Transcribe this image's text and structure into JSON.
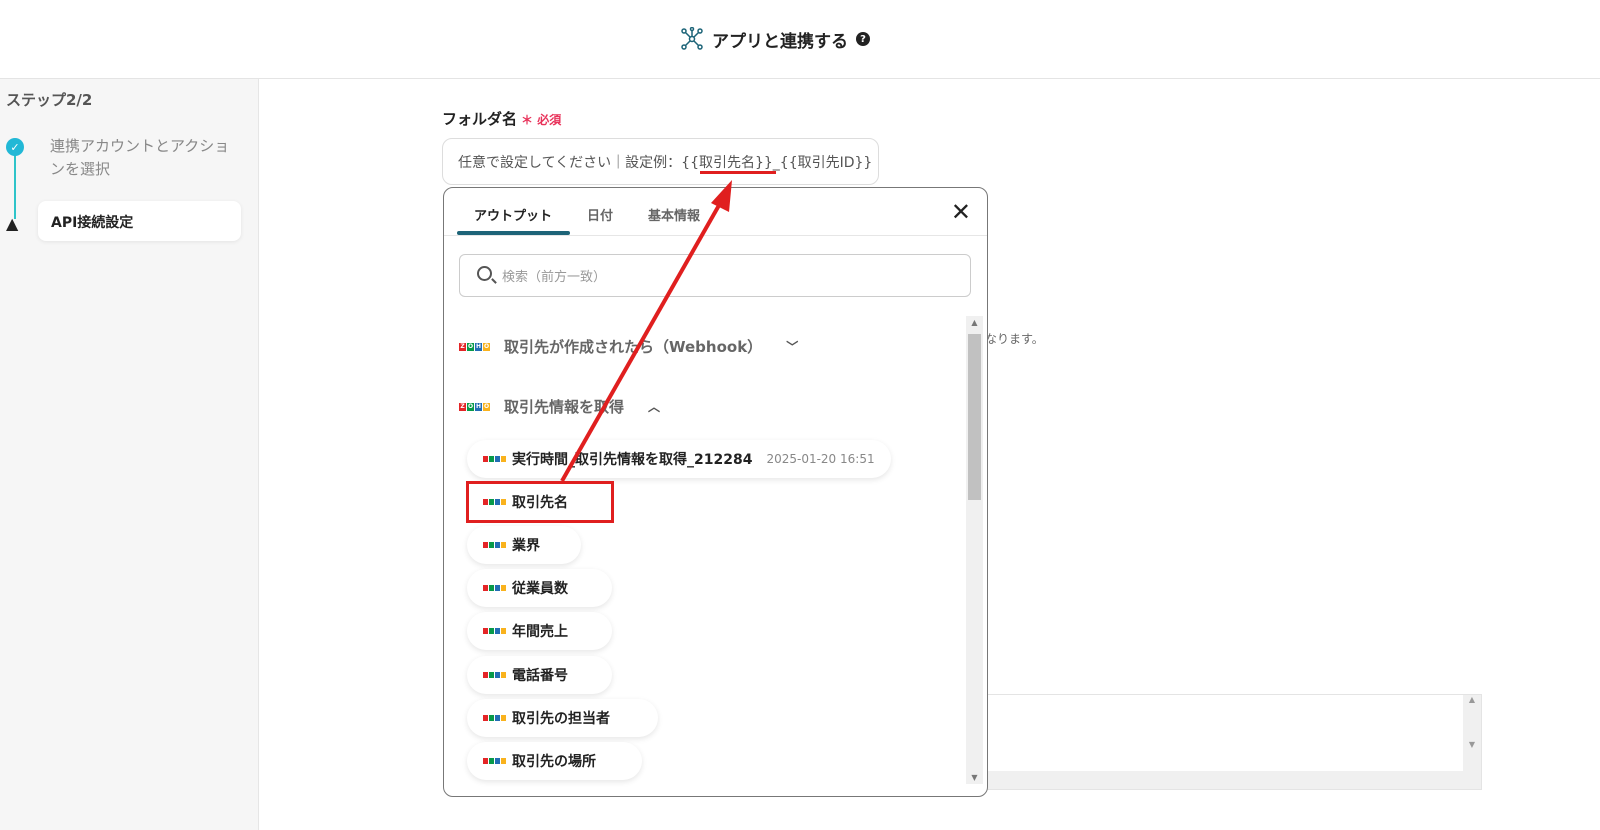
{
  "header": {
    "title": "アプリと連携する",
    "help_icon": "?"
  },
  "sidebar": {
    "step_title": "ステップ2/2",
    "steps": [
      {
        "label": "連携アカウントとアクションを選択",
        "status": "done"
      },
      {
        "label": "API接続設定",
        "status": "warning"
      }
    ]
  },
  "form": {
    "folder_label": "フォルダ名",
    "required_mark": "＊",
    "required_text": "必須",
    "placeholder": "任意で設定してください｜設定例：{{取引先名}}_{{取引先ID}}",
    "note_fragment": "なります。"
  },
  "popup": {
    "tabs": [
      "アウトプット",
      "日付",
      "基本情報"
    ],
    "active_tab": "アウトプット",
    "search_placeholder": "検索（前方一致）",
    "groups": [
      {
        "label": "取引先が作成されたら（Webhook）",
        "expanded": false
      },
      {
        "label": "取引先情報を取得",
        "expanded": true
      }
    ],
    "run_item": {
      "label": "実行時間_取引先情報を取得_212284",
      "time": "2025-01-20 16:51"
    },
    "items": [
      "取引先名",
      "業界",
      "従業員数",
      "年間売上",
      "電話番号",
      "取引先の担当者",
      "取引先の場所"
    ]
  },
  "colors": {
    "accent": "#1d6478",
    "annotation": "#e01f1f",
    "required": "#e8325a"
  }
}
